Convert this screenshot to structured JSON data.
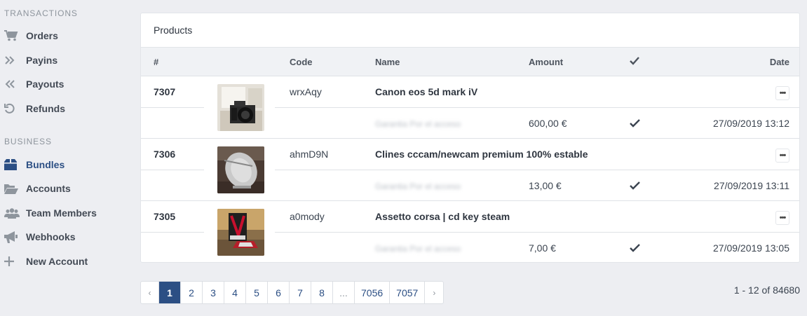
{
  "sidebar": {
    "sections": [
      {
        "title": "TRANSACTIONS",
        "items": [
          {
            "label": "Orders",
            "icon": "cart-icon"
          },
          {
            "label": "Payins",
            "icon": "double-chevron-right-icon"
          },
          {
            "label": "Payouts",
            "icon": "double-chevron-left-icon"
          },
          {
            "label": "Refunds",
            "icon": "undo-icon"
          }
        ]
      },
      {
        "title": "BUSINESS",
        "items": [
          {
            "label": "Bundles",
            "icon": "box-icon",
            "active": true
          },
          {
            "label": "Accounts",
            "icon": "folder-open-icon"
          },
          {
            "label": "Team Members",
            "icon": "users-icon"
          },
          {
            "label": "Webhooks",
            "icon": "bullhorn-icon"
          },
          {
            "label": "New Account",
            "icon": "plus-icon"
          }
        ]
      }
    ]
  },
  "card": {
    "title": "Products",
    "columns": {
      "id": "#",
      "code": "Code",
      "name": "Name",
      "amount": "Amount",
      "status_icon": "check-icon",
      "date": "Date"
    },
    "rows": [
      {
        "id": "7307",
        "code": "wrxAqy",
        "name": "Canon eos 5d mark iV",
        "detail": "Garantia Por el acceso",
        "amount": "600,00 €",
        "date": "27/09/2019 13:12",
        "thumb": "camera-thumb",
        "actions": "•••"
      },
      {
        "id": "7306",
        "code": "ahmD9N",
        "name": "Clines cccam/newcam premium 100% estable",
        "detail": "Garantia Por el acceso",
        "amount": "13,00 €",
        "date": "27/09/2019 13:11",
        "thumb": "satellite-dish-thumb",
        "actions": "•••"
      },
      {
        "id": "7305",
        "code": "a0mody",
        "name": "Assetto corsa | cd key steam",
        "detail": "Garantia Por el acceso",
        "amount": "7,00 €",
        "date": "27/09/2019 13:05",
        "thumb": "game-box-thumb",
        "actions": "•••"
      }
    ]
  },
  "pagination": {
    "prev": "‹",
    "next": "›",
    "pages": [
      "1",
      "2",
      "3",
      "4",
      "5",
      "6",
      "7",
      "8",
      "...",
      "7056",
      "7057"
    ],
    "current": "1",
    "summary": "1 - 12 of 84680"
  },
  "colors": {
    "accent": "#2c4f84",
    "background": "#edeef2",
    "table_header": "#f0f2f5"
  }
}
